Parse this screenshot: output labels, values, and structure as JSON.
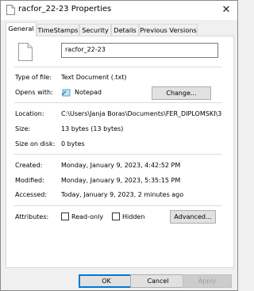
{
  "window": {
    "title": "racfor_22-23 Properties",
    "close_glyph": "✕"
  },
  "tabs": [
    {
      "label": "General",
      "active": true
    },
    {
      "label": "TimeStamps",
      "active": false
    },
    {
      "label": "Security",
      "active": false
    },
    {
      "label": "Details",
      "active": false
    },
    {
      "label": "Previous Versions",
      "active": false
    }
  ],
  "general": {
    "file_name": "racfor_22-23",
    "type_label": "Type of file:",
    "type_value": "Text Document (.txt)",
    "opens_label": "Opens with:",
    "opens_value": "Notepad",
    "change_button": "Change...",
    "location_label": "Location:",
    "location_value": "C:\\Users\\Janja Boras\\Documents\\FER_DIPLOMSKI\\3",
    "size_label": "Size:",
    "size_value": "13 bytes (13 bytes)",
    "size_on_disk_label": "Size on disk:",
    "size_on_disk_value": "0 bytes",
    "created_label": "Created:",
    "created_value": "Monday, January 9, 2023, 4:42:52 PM",
    "modified_label": "Modified:",
    "modified_value": "Monday, January 9, 2023, 5:35:15 PM",
    "accessed_label": "Accessed:",
    "accessed_value": "Today, January 9, 2023, 2 minutes ago",
    "attributes_label": "Attributes:",
    "readonly_label": "Read-only",
    "hidden_label": "Hidden",
    "advanced_button": "Advanced..."
  },
  "footer": {
    "ok": "OK",
    "cancel": "Cancel",
    "apply": "Apply"
  }
}
